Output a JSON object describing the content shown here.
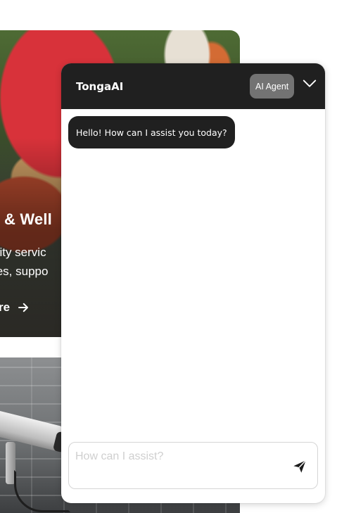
{
  "background_page": {
    "hero_card": {
      "title": "n & Well",
      "description_lines": [
        "nity servic",
        "tes, suppo"
      ],
      "link_label": "re"
    },
    "cctv_card": {}
  },
  "chat_widget": {
    "title": "TongaAI",
    "badge": "AI Agent",
    "collapse_icon": "chevron-down-icon",
    "messages": [
      {
        "role": "agent",
        "text": "Hello! How can I assist you today?"
      }
    ],
    "input": {
      "placeholder": "How can I assist?",
      "value": ""
    },
    "send_icon": "send-icon",
    "colors": {
      "header_bg": "#202020",
      "badge_bg": "#737373",
      "bubble_bg": "#202020",
      "placeholder": "#cfcfcf"
    }
  }
}
